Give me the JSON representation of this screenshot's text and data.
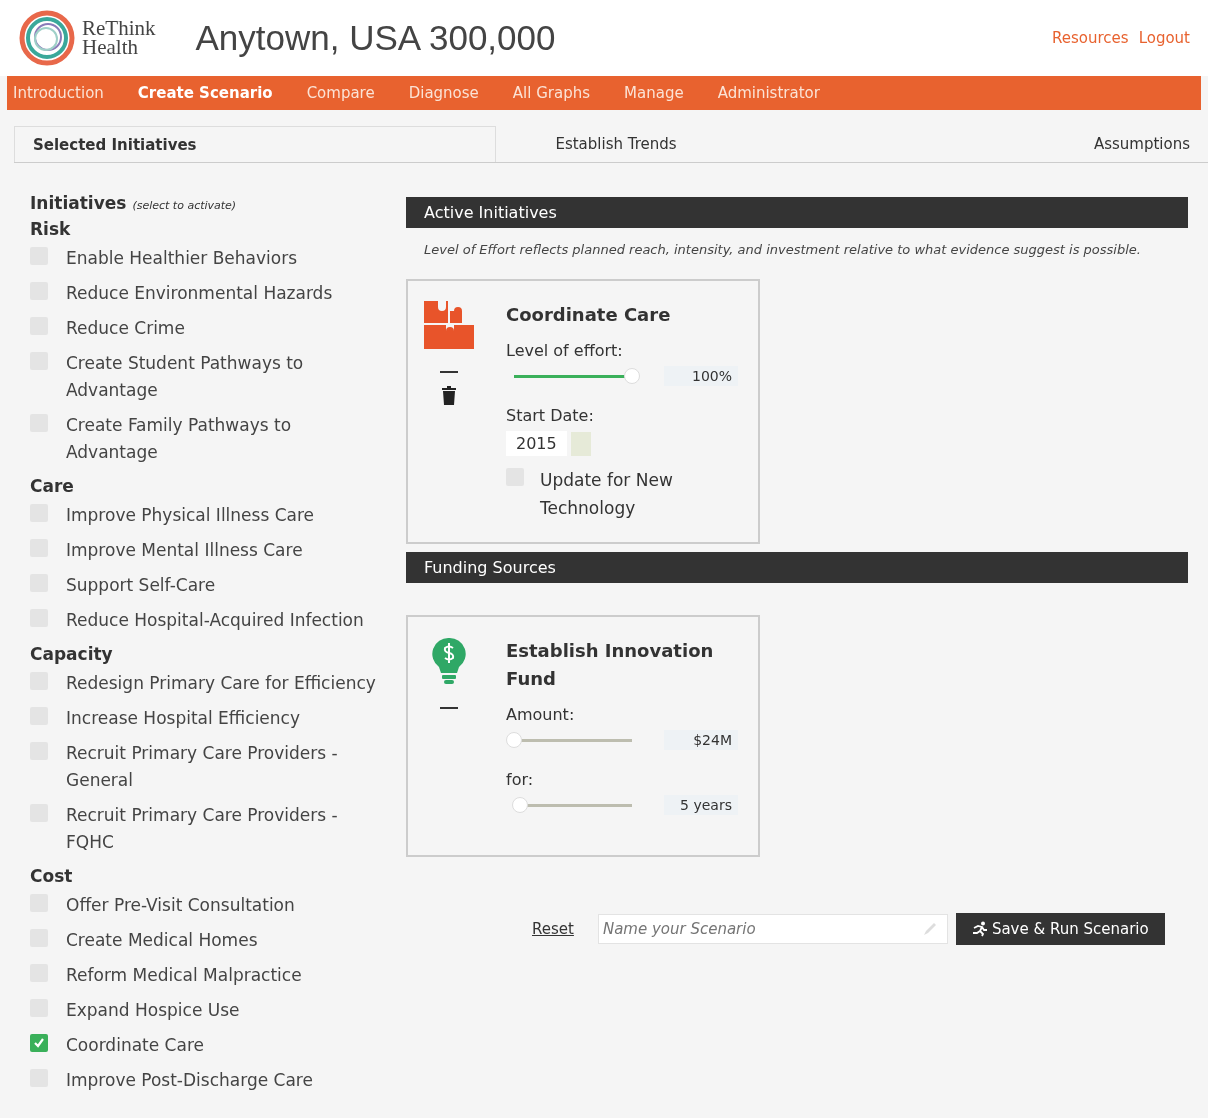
{
  "header": {
    "logo_text": [
      "ReThink",
      "Health"
    ],
    "title": "Anytown, USA 300,000",
    "links": [
      "Resources",
      "Logout"
    ]
  },
  "nav": [
    {
      "label": "Introduction",
      "selected": false
    },
    {
      "label": "Create Scenario",
      "selected": true
    },
    {
      "label": "Compare",
      "selected": false
    },
    {
      "label": "Diagnose",
      "selected": false
    },
    {
      "label": "All Graphs",
      "selected": false
    },
    {
      "label": "Manage",
      "selected": false
    },
    {
      "label": "Administrator",
      "selected": false
    }
  ],
  "tabs": [
    {
      "label": "Selected Initiatives",
      "selected": true
    },
    {
      "label": "Establish Trends",
      "selected": false
    },
    {
      "label": "Assumptions",
      "selected": false
    }
  ],
  "initiatives": {
    "title": "Initiatives",
    "hint": "(select to activate)",
    "groups": [
      {
        "name": "Risk",
        "items": [
          {
            "label": "Enable Healthier Behaviors",
            "checked": false
          },
          {
            "label": "Reduce Environmental Hazards",
            "checked": false
          },
          {
            "label": "Reduce Crime",
            "checked": false
          },
          {
            "label": "Create Student Pathways to Advantage",
            "checked": false
          },
          {
            "label": "Create Family Pathways to Advantage",
            "checked": false
          }
        ]
      },
      {
        "name": "Care",
        "items": [
          {
            "label": "Improve Physical Illness Care",
            "checked": false
          },
          {
            "label": "Improve Mental Illness Care",
            "checked": false
          },
          {
            "label": "Support Self-Care",
            "checked": false
          },
          {
            "label": "Reduce Hospital-Acquired Infection",
            "checked": false
          }
        ]
      },
      {
        "name": "Capacity",
        "items": [
          {
            "label": "Redesign Primary Care for Efficiency",
            "checked": false
          },
          {
            "label": "Increase Hospital Efficiency",
            "checked": false
          },
          {
            "label": "Recruit Primary Care Providers - General",
            "checked": false
          },
          {
            "label": "Recruit Primary Care Providers - FQHC",
            "checked": false
          }
        ]
      },
      {
        "name": "Cost",
        "items": [
          {
            "label": "Offer Pre-Visit Consultation",
            "checked": false
          },
          {
            "label": "Create Medical Homes",
            "checked": false
          },
          {
            "label": "Reform Medical Malpractice",
            "checked": false
          },
          {
            "label": "Expand Hospice Use",
            "checked": false
          },
          {
            "label": "Coordinate Care",
            "checked": true
          },
          {
            "label": "Improve Post-Discharge Care",
            "checked": false
          }
        ]
      }
    ]
  },
  "active": {
    "title": "Active Initiatives",
    "note": "Level of Effort reflects planned reach, intensity, and investment relative to what evidence suggest is possible.",
    "card": {
      "name": "Coordinate Care",
      "effort_label": "Level of effort:",
      "effort": {
        "level": 1.0,
        "reading": "100%"
      },
      "date_label": "Start Date:",
      "date": "2015",
      "update": {
        "label": "Update for New Technology",
        "checked": false
      }
    }
  },
  "funding": {
    "title": "Funding Sources",
    "card": {
      "name": "Establish Innovation Fund",
      "amount_label": "Amount:",
      "amount": {
        "level": 0.0,
        "reading": "$24M"
      },
      "for_label": "for:",
      "duration": {
        "level": 0.05,
        "reading": "5 years"
      }
    }
  },
  "footer": {
    "reset": "Reset",
    "name_field": {
      "placeholder": "Name your Scenario"
    },
    "save": "Save & Run Scenario"
  }
}
